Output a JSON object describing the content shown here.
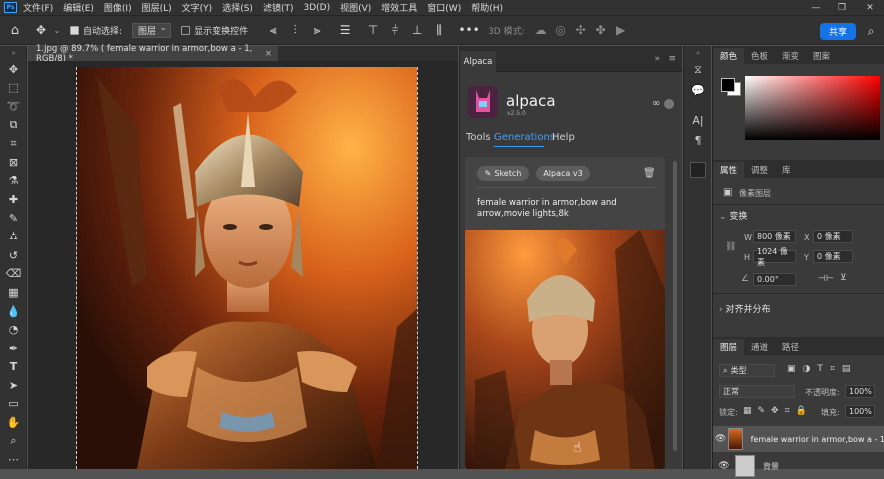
{
  "menubar": {
    "items": [
      "文件(F)",
      "编辑(E)",
      "图像(I)",
      "图层(L)",
      "文字(Y)",
      "选择(S)",
      "滤镜(T)",
      "3D(D)",
      "视图(V)",
      "增效工具",
      "窗口(W)",
      "帮助(H)"
    ],
    "logo": "Ps"
  },
  "options": {
    "auto_select_label": "自动选择:",
    "auto_select_value": "图层",
    "show_transform_label": "显示变换控件",
    "three_d_mode": "3D 模式:",
    "share_label": "共享"
  },
  "document": {
    "tab_title": "1.jpg @ 89.7% ( female warrior in armor,bow a - 1, RGB/8) *",
    "tab_close": "×"
  },
  "alpaca": {
    "panel_tab": "Alpaca",
    "title": "alpaca",
    "version": "v2.5.0",
    "nav": [
      "Tools",
      "Generations",
      "Help"
    ],
    "pill_sketch": "Sketch",
    "pill_model": "Alpaca v3",
    "prompt": "female warrior in armor,bow and arrow,movie lights,8k"
  },
  "colors": {
    "accent": "#1473e6",
    "alpaca_accent": "#3aa0ff",
    "foreground": "#000000",
    "background": "#ffffff"
  },
  "right": {
    "color_tabs": [
      "颜色",
      "色板",
      "渐变",
      "图案"
    ],
    "prop_tabs": [
      "属性",
      "调整",
      "库"
    ],
    "pixel_layer": "像素图层",
    "transform_label": "变换",
    "w_label": "W",
    "w_value": "800 像素",
    "x_label": "X",
    "x_value": "0 像素",
    "h_label": "H",
    "h_value": "1024 像素",
    "y_label": "Y",
    "y_value": "0 像素",
    "angle_value": "0.00°",
    "align_label": "对齐并分布",
    "layer_tabs": [
      "图层",
      "通道",
      "路径"
    ],
    "kind_label": "类型",
    "blend_mode": "正常",
    "opacity_label": "不透明度:",
    "opacity_value": "100%",
    "lock_label": "锁定:",
    "fill_label": "填充:",
    "fill_value": "100%",
    "layer1_name": "female warrior in armor,bow a - 1",
    "layer2_name": "背景"
  }
}
